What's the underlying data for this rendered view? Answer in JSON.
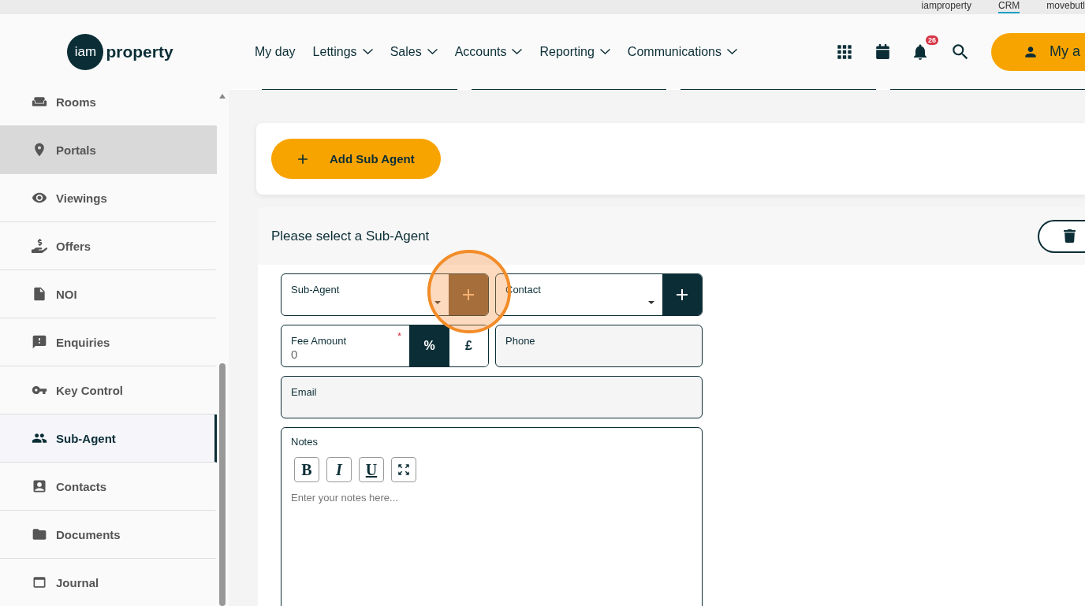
{
  "top_links": [
    {
      "label": "iamproperty",
      "selected": false
    },
    {
      "label": "CRM",
      "selected": true
    },
    {
      "label": "movebutl",
      "selected": false
    }
  ],
  "logo": {
    "circle_text": "iam",
    "word": "property"
  },
  "nav": [
    {
      "label": "My day",
      "dropdown": false
    },
    {
      "label": "Lettings",
      "dropdown": true
    },
    {
      "label": "Sales",
      "dropdown": true
    },
    {
      "label": "Accounts",
      "dropdown": true
    },
    {
      "label": "Reporting",
      "dropdown": true
    },
    {
      "label": "Communications",
      "dropdown": true
    }
  ],
  "header_actions": {
    "notification_count": "26",
    "account_label": "My a"
  },
  "sidebar": {
    "items": [
      {
        "label": "Rooms",
        "selected": false,
        "hovered": false
      },
      {
        "label": "Portals",
        "selected": false,
        "hovered": true
      },
      {
        "label": "Viewings",
        "selected": false,
        "hovered": false
      },
      {
        "label": "Offers",
        "selected": false,
        "hovered": false
      },
      {
        "label": "NOI",
        "selected": false,
        "hovered": false
      },
      {
        "label": "Enquiries",
        "selected": false,
        "hovered": false
      },
      {
        "label": "Key Control",
        "selected": false,
        "hovered": false
      },
      {
        "label": "Sub-Agent",
        "selected": true,
        "hovered": false
      },
      {
        "label": "Contacts",
        "selected": false,
        "hovered": false
      },
      {
        "label": "Documents",
        "selected": false,
        "hovered": false
      },
      {
        "label": "Journal",
        "selected": false,
        "hovered": false
      }
    ]
  },
  "add_button": {
    "label": "Add Sub Agent"
  },
  "panel": {
    "title": "Please select a Sub-Agent",
    "sub_agent": {
      "label": "Sub-Agent",
      "add_highlighted": true
    },
    "contact": {
      "label": "Contact"
    },
    "fee": {
      "label": "Fee Amount",
      "required": true,
      "required_mark": "*",
      "value": "0",
      "units": [
        {
          "label": "%",
          "selected": true
        },
        {
          "label": "£",
          "selected": false
        }
      ]
    },
    "phone": {
      "label": "Phone"
    },
    "email": {
      "label": "Email"
    },
    "notes": {
      "label": "Notes",
      "placeholder": "Enter your notes here...",
      "toolbar": [
        {
          "kind": "bold",
          "label": "B"
        },
        {
          "kind": "italic",
          "label": "I"
        },
        {
          "kind": "underline",
          "label": "U"
        },
        {
          "kind": "expand"
        }
      ]
    }
  }
}
